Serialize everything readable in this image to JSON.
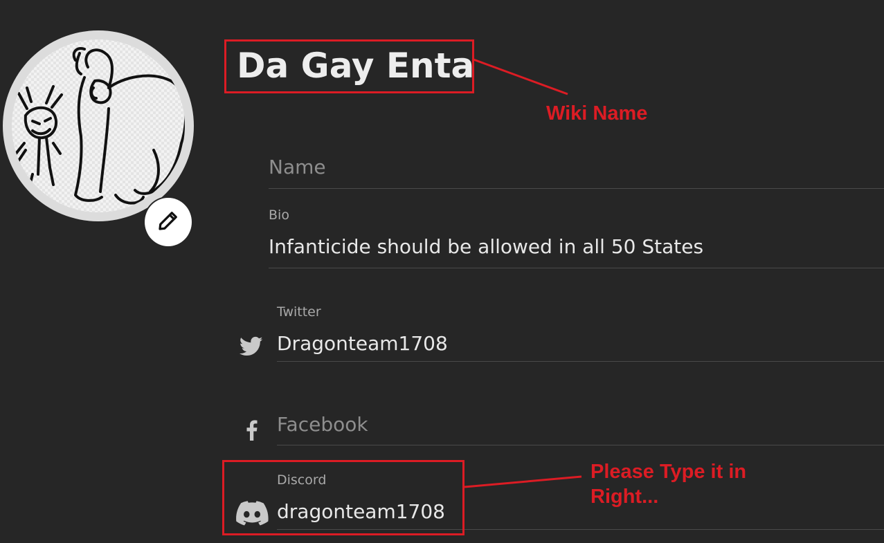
{
  "profile": {
    "wiki_name": "Da Gay Enta",
    "edit_avatar_icon": "pencil-icon"
  },
  "fields": {
    "name": {
      "placeholder": "Name",
      "value": ""
    },
    "bio": {
      "label": "Bio",
      "value": "Infanticide should be allowed in all 50 States"
    },
    "twitter": {
      "label": "Twitter",
      "value": "Dragonteam1708",
      "icon": "twitter-icon"
    },
    "facebook": {
      "placeholder": "Facebook",
      "value": "",
      "icon": "facebook-icon"
    },
    "discord": {
      "label": "Discord",
      "value": "dragonteam1708",
      "icon": "discord-icon"
    }
  },
  "annotations": {
    "wiki_name_note": "Wiki Name",
    "discord_note_line1": "Please Type it in",
    "discord_note_line2": "Right...",
    "color": "#dc1c24"
  },
  "colors": {
    "background": "#262626",
    "text": "#e8e8e8",
    "muted": "#a9a9a9",
    "divider": "#4a4a4a"
  }
}
